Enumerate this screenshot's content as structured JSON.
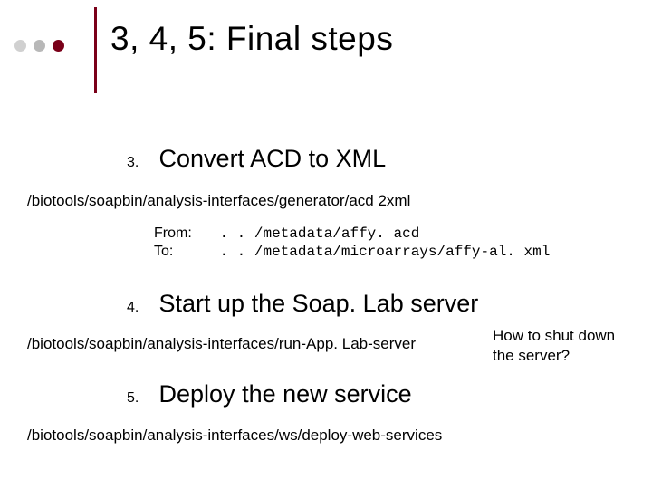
{
  "title": "3, 4, 5: Final steps",
  "steps": {
    "s3": {
      "num": "3.",
      "text": "Convert ACD to XML"
    },
    "s4": {
      "num": "4.",
      "text": "Start up the Soap. Lab server"
    },
    "s5": {
      "num": "5.",
      "text": "Deploy the new service"
    }
  },
  "paths": {
    "p1": "/biotools/soapbin/analysis-interfaces/generator/acd 2xml",
    "p2": "/biotools/soapbin/analysis-interfaces/run-App. Lab-server",
    "p3": "/biotools/soapbin/analysis-interfaces/ws/deploy-web-services"
  },
  "fromto": {
    "from_label": "From:",
    "from_value": ". . /metadata/affy. acd",
    "to_label": "To:",
    "to_value": ". . /metadata/microarrays/affy-al. xml"
  },
  "note": "How to shut down the server?"
}
